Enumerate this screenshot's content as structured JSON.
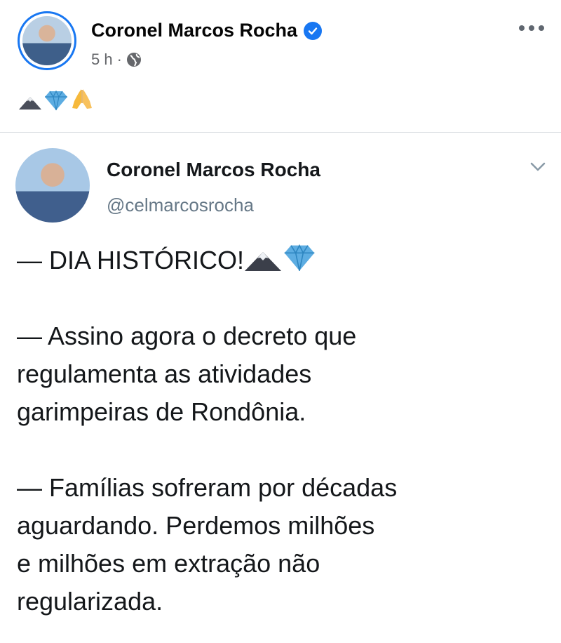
{
  "post": {
    "author": "Coronel Marcos Rocha",
    "time": "5 h",
    "separator": "·",
    "caption_icons": [
      "mountain-icon",
      "gem-icon",
      "praying-hands-icon"
    ]
  },
  "tweet": {
    "name": "Coronel Marcos Rocha",
    "handle": "@celmarcosrocha",
    "line1": "— DIA HISTÓRICO!",
    "para2_l1": "— Assino agora o decreto que",
    "para2_l2": "regulamenta as atividades",
    "para2_l3": "garimpeiras de Rondônia.",
    "para3_l1": "— Famílias sofreram por décadas",
    "para3_l2": "aguardando. Perdemos milhões",
    "para3_l3": "e milhões em extração não",
    "para3_l4": "regularizada."
  },
  "colors": {
    "accent": "#1877f2",
    "secondary_text": "#65676b",
    "tweet_handle": "#657786"
  }
}
